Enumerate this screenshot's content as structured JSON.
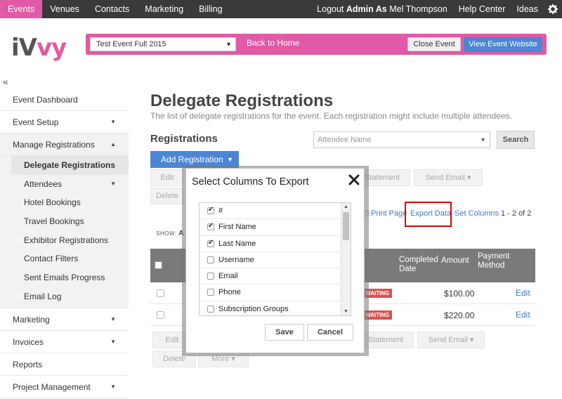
{
  "topnav": {
    "items": [
      "Events",
      "Venues",
      "Contacts",
      "Marketing",
      "Billing"
    ],
    "logout_label": "Logout",
    "admin_as": "Admin As",
    "admin_name": "Mel Thompson",
    "help_center": "Help Center",
    "ideas": "Ideas"
  },
  "header": {
    "logo_left": "iV",
    "logo_right": "vy",
    "event_selected": "Test Event Full 2015",
    "back_home": "Back to Home",
    "close_event": "Close Event",
    "view_website": "View Event Website"
  },
  "sidebar": {
    "collapse_icon": "«",
    "items": [
      "Event Dashboard",
      "Event Setup",
      "Manage Registrations",
      "Delegate Registrations",
      "Attendees",
      "Hotel Bookings",
      "Travel Bookings",
      "Exhibitor Registrations",
      "Contact Filters",
      "Sent Emails Progress",
      "Email Log",
      "Marketing",
      "Invoices",
      "Reports",
      "Project Management"
    ]
  },
  "main": {
    "title": "Delegate Registrations",
    "subtitle": "The list of delegate registrations for the event. Each registration might include multiple attendees.",
    "section": "Registrations",
    "attendee_placeholder": "Attendee Name",
    "search": "Search",
    "add_registration": "Add Registration",
    "edit": "Edit",
    "delete": "Delete",
    "more": "More",
    "statement": "Statement",
    "send_email": "Send Email",
    "print_page": "Print Page",
    "export_data": "Export Data",
    "set_columns": "Set Columns",
    "page_count": "1 - 2 of 2",
    "show_label": "SHOW:",
    "show_value": "A",
    "columns": {
      "completed_date": "Completed Date",
      "amount": "Amount",
      "payment_method": "Payment Method"
    },
    "rows": [
      {
        "status": "WAITING",
        "amount": "$100.00",
        "action": "Edit"
      },
      {
        "status": "WAITING",
        "amount": "$220.00",
        "action": "Edit"
      }
    ]
  },
  "modal": {
    "title": "Select Columns To Export",
    "columns": [
      {
        "label": "#",
        "checked": true
      },
      {
        "label": "First Name",
        "checked": true
      },
      {
        "label": "Last Name",
        "checked": true
      },
      {
        "label": "Username",
        "checked": false
      },
      {
        "label": "Email",
        "checked": false
      },
      {
        "label": "Phone",
        "checked": false
      },
      {
        "label": "Subscription Groups",
        "checked": false
      }
    ],
    "save": "Save",
    "cancel": "Cancel"
  },
  "colors": {
    "brand_pink": "#e05aa5",
    "primary_blue": "#4a86d4",
    "topbar": "#3a3a3a",
    "highlight_red": "#dd0000"
  }
}
